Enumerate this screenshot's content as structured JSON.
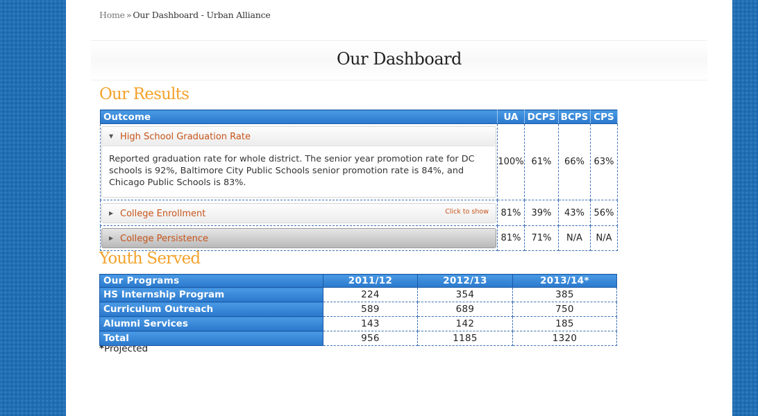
{
  "breadcrumb": {
    "home": "Home",
    "separator": "»",
    "current": "Our Dashboard - Urban Alliance"
  },
  "page_title": "Our Dashboard",
  "results": {
    "heading": "Our Results",
    "columns": [
      "Outcome",
      "UA",
      "DCPS",
      "BCPS",
      "CPS"
    ],
    "rows": [
      {
        "title": "High School Graduation Rate",
        "expanded": true,
        "description": "Reported graduation rate for whole district. The senior year promotion rate for DC schools is 92%, Baltimore City Public Schools senior promotion rate is 84%, and Chicago Public Schools is 83%.",
        "values": [
          "100%",
          "61%",
          "66%",
          "63%"
        ]
      },
      {
        "title": "College Enrollment",
        "expanded": false,
        "hint": "Click to show",
        "values": [
          "81%",
          "39%",
          "43%",
          "56%"
        ]
      },
      {
        "title": "College Persistence",
        "expanded": false,
        "hovered": true,
        "values": [
          "81%",
          "71%",
          "N/A",
          "N/A"
        ]
      }
    ]
  },
  "youth": {
    "heading": "Youth Served",
    "columns": [
      "Our Programs",
      "2011/12",
      "2012/13",
      "2013/14*"
    ],
    "rows": [
      {
        "label": "HS Internship Program",
        "values": [
          "224",
          "354",
          "385"
        ]
      },
      {
        "label": "Curriculum Outreach",
        "values": [
          "589",
          "689",
          "750"
        ]
      },
      {
        "label": "Alumni Services",
        "values": [
          "143",
          "142",
          "185"
        ]
      },
      {
        "label": "Total",
        "values": [
          "956",
          "1185",
          "1320"
        ]
      }
    ],
    "footnote_mark": "*",
    "footnote_text": "Projected"
  },
  "colors": {
    "accent_orange": "#f3a22b",
    "link_orange": "#c6541a",
    "header_blue": "#2a78cc",
    "page_bg_blue": "#1f6fb5"
  }
}
